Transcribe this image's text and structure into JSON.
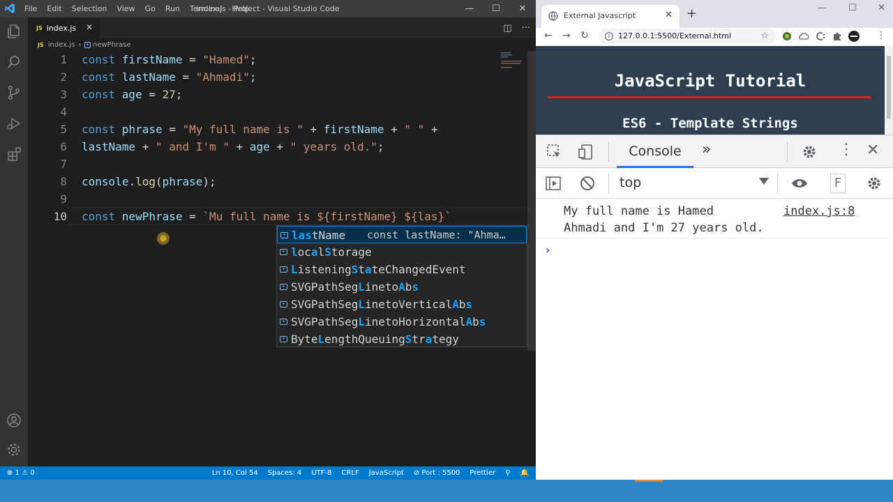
{
  "vscode": {
    "menu": [
      "File",
      "Edit",
      "Selection",
      "View",
      "Go",
      "Run",
      "Terminal",
      "Help"
    ],
    "window_title": "index.js - Project - Visual Studio Code",
    "tab": {
      "label": "index.js",
      "badge": "JS"
    },
    "breadcrumb": {
      "file": "index.js",
      "symbol": "newPhrase"
    },
    "lines": [
      {
        "n": "1",
        "tokens": [
          [
            "kw",
            "const "
          ],
          [
            "vr",
            "firstName"
          ],
          [
            "op",
            " = "
          ],
          [
            "st",
            "\"Hamed\""
          ],
          [
            "op",
            ";"
          ]
        ]
      },
      {
        "n": "2",
        "tokens": [
          [
            "kw",
            "const "
          ],
          [
            "vr",
            "lastName"
          ],
          [
            "op",
            " = "
          ],
          [
            "st",
            "\"Ahmadi\""
          ],
          [
            "op",
            ";"
          ]
        ]
      },
      {
        "n": "3",
        "tokens": [
          [
            "kw",
            "const "
          ],
          [
            "vr",
            "age"
          ],
          [
            "op",
            " = "
          ],
          [
            "nu",
            "27"
          ],
          [
            "op",
            ";"
          ]
        ]
      },
      {
        "n": "4",
        "tokens": []
      },
      {
        "n": "5",
        "tokens": [
          [
            "kw",
            "const "
          ],
          [
            "vr",
            "phrase"
          ],
          [
            "op",
            " = "
          ],
          [
            "st",
            "\"My full name is \""
          ],
          [
            "op",
            " + "
          ],
          [
            "vr",
            "firstName"
          ],
          [
            "op",
            " + "
          ],
          [
            "st",
            "\" \""
          ],
          [
            "op",
            " +"
          ]
        ]
      },
      {
        "n": "6",
        "tokens": [
          [
            "vr",
            "lastName"
          ],
          [
            "op",
            " + "
          ],
          [
            "st",
            "\" and I'm \""
          ],
          [
            "op",
            " + "
          ],
          [
            "vr",
            "age"
          ],
          [
            "op",
            " + "
          ],
          [
            "st",
            "\" years old.\""
          ],
          [
            "op",
            ";"
          ]
        ]
      },
      {
        "n": "7",
        "tokens": []
      },
      {
        "n": "8",
        "tokens": [
          [
            "vr",
            "console"
          ],
          [
            "op",
            "."
          ],
          [
            "fn",
            "log"
          ],
          [
            "op",
            "("
          ],
          [
            "vr",
            "phrase"
          ],
          [
            "op",
            ");"
          ]
        ]
      },
      {
        "n": "9",
        "tokens": []
      },
      {
        "n": "10",
        "tokens": [
          [
            "kw",
            "const "
          ],
          [
            "vr",
            "newPhrase"
          ],
          [
            "op",
            " = "
          ],
          [
            "st",
            "`Mu full name is ${firstName} ${las}`"
          ]
        ]
      }
    ],
    "suggestions": [
      {
        "parts": [
          [
            "h",
            "las"
          ],
          [
            "n",
            "tName"
          ]
        ],
        "detail": "const lastName: \"Ahma…"
      },
      {
        "parts": [
          [
            "h",
            "l"
          ],
          [
            "n",
            "oc"
          ],
          [
            "h",
            "a"
          ],
          [
            "n",
            "l"
          ],
          [
            "h",
            "S"
          ],
          [
            "n",
            "torage"
          ]
        ]
      },
      {
        "parts": [
          [
            "h",
            "L"
          ],
          [
            "n",
            "istening"
          ],
          [
            "h",
            "S"
          ],
          [
            "n",
            "t"
          ],
          [
            "h",
            "a"
          ],
          [
            "n",
            "teChangedEvent"
          ]
        ]
      },
      {
        "parts": [
          [
            "n",
            "SVGPathSeg"
          ],
          [
            "h",
            "L"
          ],
          [
            "n",
            "ineto"
          ],
          [
            "h",
            "A"
          ],
          [
            "n",
            "b"
          ],
          [
            "h",
            "s"
          ]
        ]
      },
      {
        "parts": [
          [
            "n",
            "SVGPathSeg"
          ],
          [
            "h",
            "L"
          ],
          [
            "n",
            "inetoVertical"
          ],
          [
            "h",
            "A"
          ],
          [
            "n",
            "b"
          ],
          [
            "h",
            "s"
          ]
        ]
      },
      {
        "parts": [
          [
            "n",
            "SVGPathSeg"
          ],
          [
            "h",
            "L"
          ],
          [
            "n",
            "inetoHorizontal"
          ],
          [
            "h",
            "A"
          ],
          [
            "n",
            "b"
          ],
          [
            "h",
            "s"
          ]
        ]
      },
      {
        "parts": [
          [
            "n",
            "Byte"
          ],
          [
            "h",
            "L"
          ],
          [
            "n",
            "engthQueuing"
          ],
          [
            "h",
            "S"
          ],
          [
            "n",
            "tr"
          ],
          [
            "h",
            "a"
          ],
          [
            "n",
            "tegy"
          ]
        ]
      }
    ],
    "status": {
      "problems": "⊗ 1 ⚠ 0",
      "items": [
        "Ln 10, Col 54",
        "Spaces: 4",
        "UTF-8",
        "CRLF",
        "JavaScript",
        "⊘ Port : 5500",
        "Prettier",
        "⚲",
        "🔔"
      ]
    }
  },
  "chrome": {
    "tab_title": "External Javascript",
    "url": "127.0.0.1:5500/External.html",
    "page_heading": "JavaScript Tutorial",
    "page_subheading": "ES6 - Template Strings",
    "devtools": {
      "console_tab": "Console",
      "context": "top",
      "filter_placeholder": "F",
      "log_line1": "My full name is Hamed",
      "log_line2": "Ahmadi and I'm 27 years old.",
      "log_source": "index.js:8",
      "prompt": "›"
    }
  },
  "colors": {
    "vs_accent": "#007acc",
    "chrome_accent": "#1a73e8",
    "page_bg": "#2c3e50",
    "page_rule": "#e0201c"
  }
}
